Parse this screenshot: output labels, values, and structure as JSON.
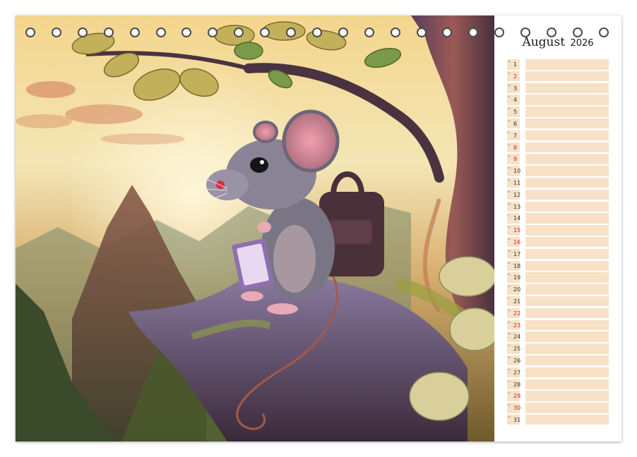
{
  "calendar": {
    "month": "August",
    "year": "2026",
    "days": [
      {
        "wd": "Sa",
        "d": "1",
        "red": false
      },
      {
        "wd": "So",
        "d": "2",
        "red": true
      },
      {
        "wd": "Mo",
        "d": "3",
        "red": false
      },
      {
        "wd": "Di",
        "d": "4",
        "red": false
      },
      {
        "wd": "Mi",
        "d": "5",
        "red": false
      },
      {
        "wd": "Do",
        "d": "6",
        "red": false
      },
      {
        "wd": "Fr",
        "d": "7",
        "red": false
      },
      {
        "wd": "Sa",
        "d": "8",
        "red": true
      },
      {
        "wd": "So",
        "d": "9",
        "red": true
      },
      {
        "wd": "Mo",
        "d": "10",
        "red": false
      },
      {
        "wd": "Di",
        "d": "11",
        "red": false
      },
      {
        "wd": "Mi",
        "d": "12",
        "red": false
      },
      {
        "wd": "Do",
        "d": "13",
        "red": false
      },
      {
        "wd": "Fr",
        "d": "14",
        "red": false
      },
      {
        "wd": "Sa",
        "d": "15",
        "red": true
      },
      {
        "wd": "So",
        "d": "16",
        "red": true
      },
      {
        "wd": "Mo",
        "d": "17",
        "red": false
      },
      {
        "wd": "Di",
        "d": "18",
        "red": false
      },
      {
        "wd": "Mi",
        "d": "19",
        "red": false
      },
      {
        "wd": "Do",
        "d": "20",
        "red": false
      },
      {
        "wd": "Fr",
        "d": "21",
        "red": false
      },
      {
        "wd": "Sa",
        "d": "22",
        "red": true
      },
      {
        "wd": "So",
        "d": "23",
        "red": true
      },
      {
        "wd": "Mo",
        "d": "24",
        "red": false
      },
      {
        "wd": "Di",
        "d": "25",
        "red": false
      },
      {
        "wd": "Mi",
        "d": "26",
        "red": false
      },
      {
        "wd": "Do",
        "d": "27",
        "red": false
      },
      {
        "wd": "Fr",
        "d": "28",
        "red": false
      },
      {
        "wd": "Sa",
        "d": "29",
        "red": true
      },
      {
        "wd": "So",
        "d": "30",
        "red": true
      },
      {
        "wd": "Mo",
        "d": "31",
        "red": false
      }
    ]
  },
  "colors": {
    "cell": "#f7e1c7",
    "weekend": "#c62828",
    "ring": "#4a4a4a"
  }
}
